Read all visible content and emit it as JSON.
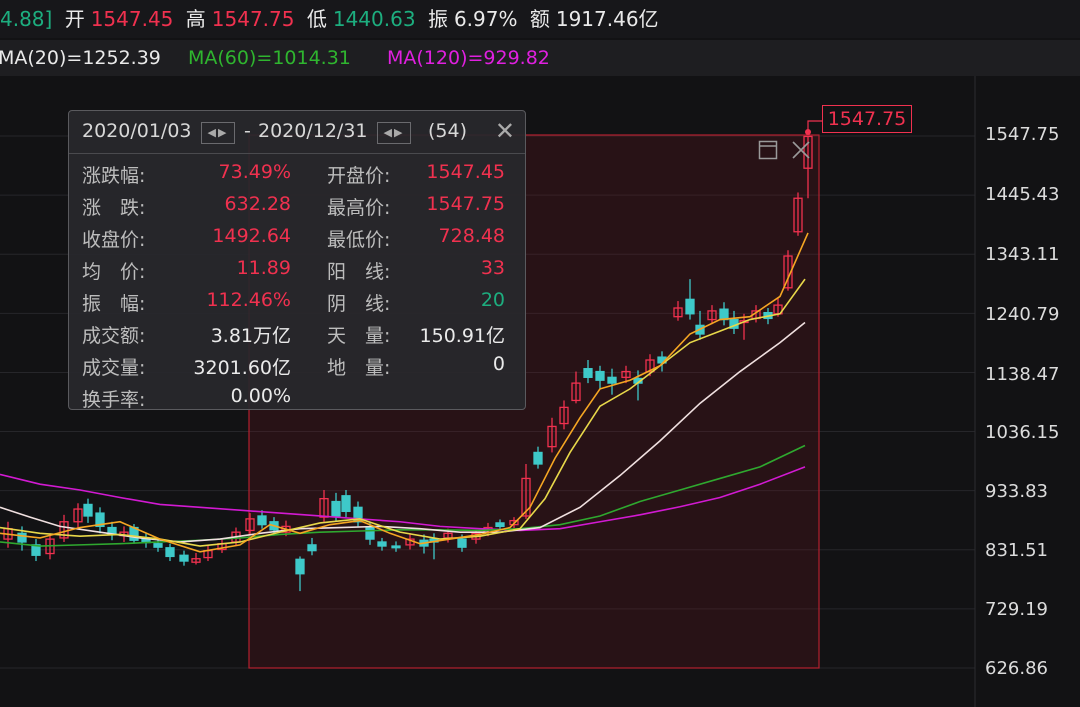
{
  "topbar": {
    "prev_close_tail": "4.88]",
    "open_label": "开",
    "open": "1547.45",
    "high_label": "高",
    "high": "1547.75",
    "low_label": "低",
    "low": "1440.63",
    "amp_label": "振",
    "amp": "6.97%",
    "amount_label": "额",
    "amount": "1917.46亿"
  },
  "ma": {
    "ma20": "MA(20)=1252.39",
    "ma60": "MA(60)=1014.31",
    "ma120": "MA(120)=929.82"
  },
  "tooltip": {
    "date_start": "2020/01/03",
    "date_sep": "-",
    "date_end": "2020/12/31",
    "count": "(54)",
    "rows": [
      {
        "l1": "涨跌幅:",
        "v1": "73.49%",
        "l2": "开盘价:",
        "v2": "1547.45"
      },
      {
        "l1": "涨　跌:",
        "v1": "632.28",
        "l2": "最高价:",
        "v2": "1547.75"
      },
      {
        "l1": "收盘价:",
        "v1": "1492.64",
        "l2": "最低价:",
        "v2": "728.48"
      },
      {
        "l1": "均　价:",
        "v1": "11.89",
        "l2": "阳　线:",
        "v2": "33"
      },
      {
        "l1": "振　幅:",
        "v1": "112.46%",
        "l2": "阴　线:",
        "v2": "20"
      },
      {
        "l1": "成交额:",
        "v1": "3.81万亿",
        "l2": "天　量:",
        "v2": "150.91亿"
      },
      {
        "l1": "成交量:",
        "v1": "3201.60亿",
        "l2": "地　量:",
        "v2": "0"
      },
      {
        "l1": "换手率:",
        "v1": "0.00%",
        "l2": "",
        "v2": ""
      }
    ]
  },
  "price_tag": "1547.75",
  "axis_ticks": [
    "1547.75",
    "1445.43",
    "1343.11",
    "1240.79",
    "1138.47",
    "1036.15",
    "933.83",
    "831.51",
    "729.19",
    "626.86"
  ],
  "colors": {
    "up": "#f0314f",
    "down": "#3ec9c9",
    "ma5": "#f5a623",
    "ma10": "#e8d84a",
    "ma20": "#f0e0e0",
    "ma60": "#2fa82f",
    "ma120": "#d21ad2"
  },
  "icons": {
    "window": "window-icon",
    "close": "close-icon"
  }
}
